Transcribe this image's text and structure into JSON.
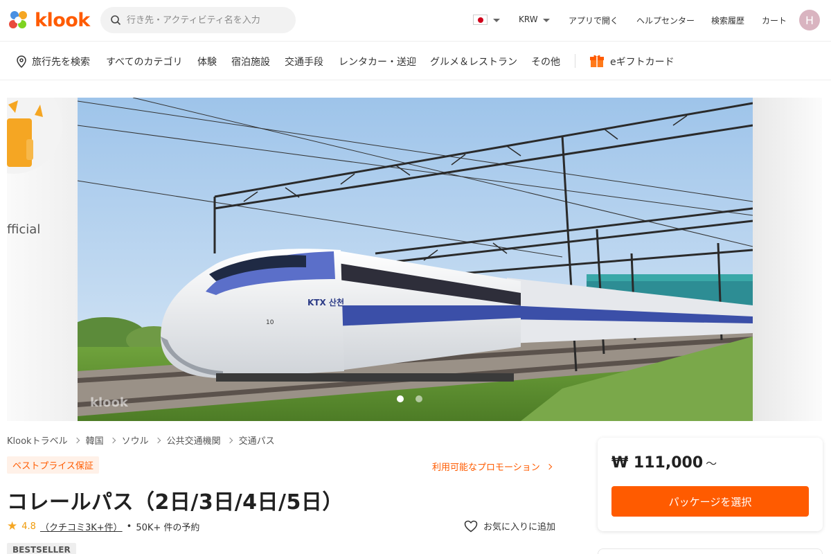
{
  "header": {
    "brand": "klook",
    "search_placeholder": "行き先・アクティビティ名を入力",
    "currency": "KRW",
    "links": [
      "アプリで開く",
      "ヘルプセンター",
      "検索履歴",
      "カート"
    ],
    "avatar_initial": "H"
  },
  "nav": {
    "search_destination": "旅行先を検索",
    "items": [
      "すべてのカテゴリ",
      "体験",
      "宿泊施設",
      "交通手段",
      "レンタカー・送迎",
      "グルメ＆レストラン",
      "その他"
    ],
    "gift_card": "eギフトカード"
  },
  "banner": {
    "side_text": "fficial",
    "watermark": "klook",
    "slide_count": 2,
    "active_slide": 1,
    "train_lettering": "KTX 산천"
  },
  "breadcrumb": [
    "Klookトラベル",
    "韓国",
    "ソウル",
    "公共交通機関",
    "交通パス"
  ],
  "product": {
    "badge": "ベストプライス保証",
    "promotion_link": "利用可能なプロモーション",
    "title": "コレールパス（2日/3日/4日/5日）",
    "rating": "4.8",
    "reviews": "（クチコミ3K+件）",
    "bullet": "•",
    "bookings": "50K+ 件の予約",
    "favorite": "お気に入りに追加",
    "tag": "BESTSELLER"
  },
  "price_card": {
    "price": "₩ 111,000",
    "suffix": "～",
    "button": "パッケージを選択"
  },
  "colors": {
    "accent": "#ff5b00",
    "rating": "#f5a623"
  }
}
